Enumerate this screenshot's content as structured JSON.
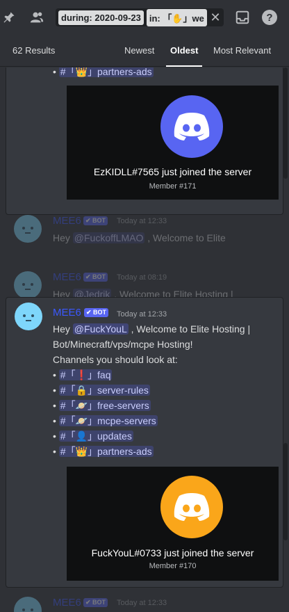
{
  "toolbar": {
    "pin_icon": "pin-icon",
    "members_icon": "members-icon",
    "inbox_icon": "inbox-icon",
    "help_icon": "help-icon"
  },
  "search": {
    "during_chip": "during: 2020-09-23",
    "in_chip": "in: 「✋」we",
    "clear": "✕"
  },
  "sort": {
    "results_count": "62 Results",
    "tabs": [
      "Newest",
      "Oldest",
      "Most Relevant"
    ],
    "active_tab": "Oldest"
  },
  "result1": {
    "channel_line": "#「👑」partners-ads",
    "embed_title": "EzKIDLL#7565 just joined the server",
    "embed_sub": "Member #171",
    "logo_color": "#5865f2"
  },
  "ghost1": {
    "username": "MEE6",
    "bot": "✔ BOT",
    "time": "Today at 12:33",
    "text_before": "Hey ",
    "mention": "@FuckoffLMAO",
    "text_after": " , Welcome to Elite"
  },
  "ghost2": {
    "username": "MEE6",
    "bot": "✔ BOT",
    "time": "Today at 08:19",
    "text_before": "Hey ",
    "mention": "@Jedrik",
    "text_after": " , Welcome to Elite Hosting |"
  },
  "main": {
    "username": "MEE6",
    "bot": "✔ BOT",
    "time": "Today at 12:33",
    "line1_before": "Hey ",
    "mention": "@FuckYouL",
    "line1_after": " , Welcome to Elite Hosting |",
    "line2": "Bot/Minecraft/vps/mcpe Hosting!",
    "line3": "Channels you should look at:",
    "channels": [
      "#「❗」faq",
      "#「🔒」server-rules",
      "#「🪐」free-servers",
      "#「🪐」mcpe-servers",
      "#「👤」updates",
      "#「👑」partners-ads"
    ],
    "embed_title": "FuckYouL#0733 just joined the server",
    "embed_sub": "Member #170",
    "logo_color": "#faa61a"
  },
  "ghost3": {
    "username": "MEE6",
    "bot": "✔ BOT",
    "time": "Today at 12:33"
  },
  "colors": {
    "background": "#2f3136",
    "card": "#36393f",
    "blurple": "#5865f2",
    "mee6_name": "#3b58ff",
    "avatar": "#7ed6fb",
    "orange_logo": "#faa61a"
  }
}
